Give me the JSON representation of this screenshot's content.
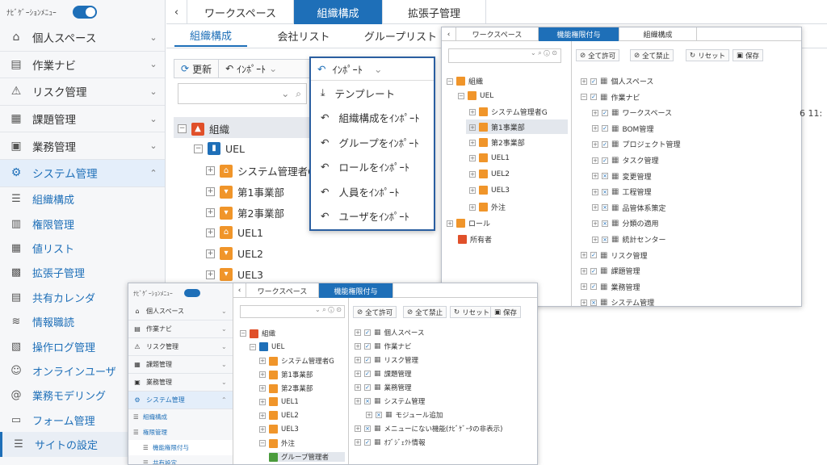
{
  "sidebar": {
    "nav_label": "ﾅﾋﾞｹﾞｰｼｮﾝﾒﾆｭｰ",
    "cats": [
      {
        "label": "個人スペース",
        "icon": "home-icon"
      },
      {
        "label": "作業ナビ",
        "icon": "printer-icon"
      },
      {
        "label": "リスク管理",
        "icon": "warning-icon"
      },
      {
        "label": "課題管理",
        "icon": "document-icon"
      },
      {
        "label": "業務管理",
        "icon": "tray-icon"
      },
      {
        "label": "システム管理",
        "icon": "gear-icon"
      }
    ],
    "subs": [
      "組織構成",
      "権限管理",
      "値リスト",
      "拡張子管理",
      "共有カレンダ",
      "情報職読",
      "操作ログ管理",
      "オンラインユーザ",
      "業務モデリング",
      "フォーム管理",
      "サイトの設定"
    ]
  },
  "main": {
    "tabs": [
      "ワークスペース",
      "組織構成",
      "拡張子管理"
    ],
    "subtabs": [
      "組織構成",
      "会社リスト",
      "グループリスト"
    ],
    "toolbar": {
      "refresh": "更新",
      "import": "ｲﾝﾎﾟｰﾄ"
    },
    "tree": [
      "組織",
      "UEL",
      "システム管理者G",
      "第1事業部",
      "第2事業部",
      "UEL1",
      "UEL2",
      "UEL3"
    ]
  },
  "dropdown": {
    "title": "ｲﾝﾎﾟｰﾄ",
    "items": [
      "テンプレート",
      "組織構成をｲﾝﾎﾟｰﾄ",
      "グループをｲﾝﾎﾟｰﾄ",
      "ロールをｲﾝﾎﾟｰﾄ",
      "人員をｲﾝﾎﾟｰﾄ",
      "ユーザをｲﾝﾎﾟｰﾄ"
    ]
  },
  "panel_right": {
    "tabs": [
      "ワークスペース",
      "機能権限付与",
      "組織構成"
    ],
    "buttons": [
      "全て許可",
      "全て禁止",
      "リセット",
      "保存"
    ],
    "tree": [
      "組織",
      "UEL",
      "システム管理者G",
      "第1事業部",
      "第2事業部",
      "UEL1",
      "UEL2",
      "UEL3",
      "外注",
      "ロール",
      "所有者"
    ],
    "perms": [
      "個人スペース",
      "作業ナビ",
      "ワークスペース",
      "BOM管理",
      "プロジェクト管理",
      "タスク管理",
      "変更管理",
      "工程管理",
      "品管体系策定",
      "分類の適用",
      "統計センター",
      "リスク管理",
      "課題管理",
      "業務管理",
      "システム管理"
    ],
    "edge_text": "6 11:"
  },
  "panel_bottom": {
    "nav_label": "ﾅﾋﾞｹﾞｰｼｮﾝﾒﾆｭｰ",
    "cats": [
      "個人スペース",
      "作業ナビ",
      "リスク管理",
      "課題管理",
      "業務管理",
      "システム管理"
    ],
    "subs": [
      "組織構成",
      "権限管理",
      "機能権限付与",
      "共有設定"
    ],
    "tabs": [
      "ワークスペース",
      "機能権限付与"
    ],
    "buttons": [
      "全て許可",
      "全て禁止",
      "リセット",
      "保存"
    ],
    "tree": [
      "組織",
      "UEL",
      "システム管理者G",
      "第1事業部",
      "第2事業部",
      "UEL1",
      "UEL2",
      "UEL3",
      "外注",
      "グループ管理者"
    ],
    "perms": [
      "個人スペース",
      "作業ナビ",
      "リスク管理",
      "課題管理",
      "業務管理",
      "システム管理",
      "モジュール追加",
      "メニューにない機能(ﾅﾋﾞｹﾞｰﾀの非表示)",
      "ｵﾌﾞｼﾞｪｸﾄ情報"
    ]
  }
}
